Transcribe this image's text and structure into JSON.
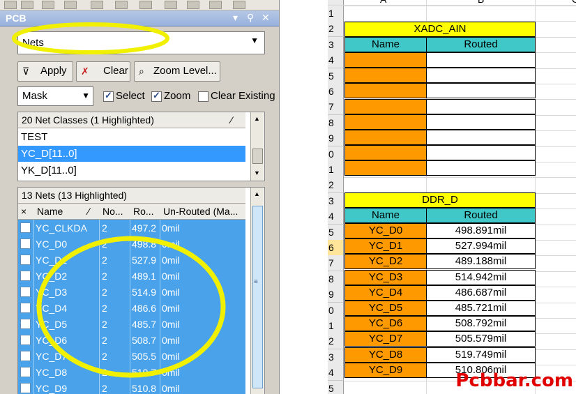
{
  "pcb_panel": {
    "title": "PCB",
    "mode_combo": "Nets",
    "buttons": {
      "apply": "Apply",
      "clear": "Clear",
      "zoom_level": "Zoom Level..."
    },
    "mask_combo": "Mask",
    "options": {
      "select": "Select",
      "zoom": "Zoom",
      "clear_existing": "Clear Existing"
    },
    "net_classes": {
      "header": "20 Net Classes (1 Highlighted)",
      "items": [
        "TEST",
        "YC_D[11..0]",
        "YK_D[11..0]"
      ],
      "selected_index": 1
    },
    "nets": {
      "header": "13 Nets (13 Highlighted)",
      "columns": [
        "×",
        "Name",
        "No...",
        "Ro...",
        "Un-Routed (Ma..."
      ],
      "rows": [
        {
          "name": "YC_CLKDA",
          "nodes": "2",
          "routed": "497.2",
          "unrouted": "0mil"
        },
        {
          "name": "YC_D0",
          "nodes": "2",
          "routed": "498.8",
          "unrouted": "0mil"
        },
        {
          "name": "YC_D1",
          "nodes": "2",
          "routed": "527.9",
          "unrouted": "0mil"
        },
        {
          "name": "YC_D2",
          "nodes": "2",
          "routed": "489.1",
          "unrouted": "0mil"
        },
        {
          "name": "YC_D3",
          "nodes": "2",
          "routed": "514.9",
          "unrouted": "0mil"
        },
        {
          "name": "YC_D4",
          "nodes": "2",
          "routed": "486.6",
          "unrouted": "0mil"
        },
        {
          "name": "YC_D5",
          "nodes": "2",
          "routed": "485.7",
          "unrouted": "0mil"
        },
        {
          "name": "YC_D6",
          "nodes": "2",
          "routed": "508.7",
          "unrouted": "0mil"
        },
        {
          "name": "YC_D7",
          "nodes": "2",
          "routed": "505.5",
          "unrouted": "0mil"
        },
        {
          "name": "YC_D8",
          "nodes": "2",
          "routed": "519.7",
          "unrouted": "0mil"
        },
        {
          "name": "YC_D9",
          "nodes": "2",
          "routed": "510.8",
          "unrouted": "0mil"
        }
      ]
    }
  },
  "spreadsheet": {
    "column_headers": [
      "A",
      "B",
      "C"
    ],
    "row_numbers": [
      "1",
      "2",
      "3",
      "4",
      "5",
      "6",
      "7",
      "8",
      "9",
      "0",
      "1",
      "2",
      "3",
      "4",
      "5",
      "6",
      "7",
      "8",
      "9",
      "0",
      "1",
      "2",
      "3",
      "4",
      "5"
    ],
    "xadc_table": {
      "title": "XADC_AIN",
      "name_header": "Name",
      "routed_header": "Routed"
    },
    "ddr_table": {
      "title": "DDR_D",
      "name_header": "Name",
      "routed_header": "Routed",
      "rows": [
        {
          "name": "YC_D0",
          "routed": "498.891mil"
        },
        {
          "name": "YC_D1",
          "routed": "527.994mil"
        },
        {
          "name": "YC_D2",
          "routed": "489.188mil"
        },
        {
          "name": "YC_D3",
          "routed": "514.942mil"
        },
        {
          "name": "YC_D4",
          "routed": "486.687mil"
        },
        {
          "name": "YC_D5",
          "routed": "485.721mil"
        },
        {
          "name": "YC_D6",
          "routed": "508.792mil"
        },
        {
          "name": "YC_D7",
          "routed": "505.579mil"
        },
        {
          "name": "YC_D8",
          "routed": "519.749mil"
        },
        {
          "name": "YC_D9",
          "routed": "510.806mil"
        }
      ]
    }
  },
  "watermark": "Pcbbar.com",
  "colors": {
    "selection": "#4aa3ea",
    "header_yellow": "#ffff00",
    "header_teal": "#40c8c8",
    "name_orange": "#ff9900",
    "highlight_ellipse": "#f0f000",
    "watermark": "#e00000"
  }
}
